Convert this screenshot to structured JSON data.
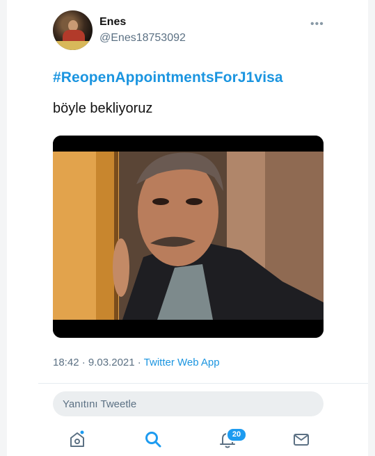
{
  "tweet": {
    "author_name": "Enes",
    "author_handle": "@Enes18753092",
    "more_icon": "more-dots-icon",
    "hashtag": "#ReopenAppointmentsForJ1visa",
    "text": "böyle bekliyoruz",
    "time": "18:42 · 9.03.2021 · ",
    "source": "Twitter Web App"
  },
  "reply": {
    "placeholder": "Yanıtını Tweetle"
  },
  "bottom_nav": {
    "items": [
      {
        "icon": "home-icon"
      },
      {
        "icon": "search-icon"
      },
      {
        "icon": "notifications-bell-icon",
        "badge": "20"
      },
      {
        "icon": "messages-envelope-icon"
      }
    ]
  },
  "colors": {
    "link": "#1b95e0",
    "secondary_text": "#5b7083",
    "badge": "#1d9bf0"
  }
}
